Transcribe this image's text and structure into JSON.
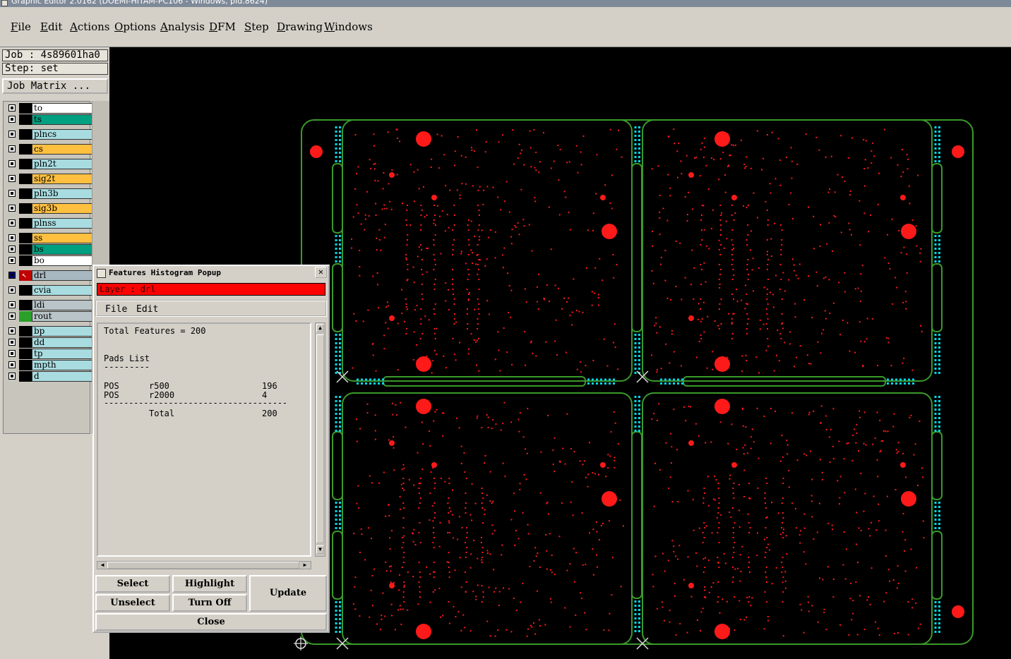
{
  "window": {
    "title": "Graphic Editor 2.0162 (DOEMI-HITAM-PC106 - Windows, pid.8624)"
  },
  "menu": {
    "items": [
      "File",
      "Edit",
      "Actions",
      "Options",
      "Analysis",
      "DFM",
      "Step",
      "Drawing",
      "Windows"
    ]
  },
  "job": {
    "job_label": "Job : 4s89601ha0",
    "step_label": "Step: set",
    "matrix_button": "Job Matrix ..."
  },
  "layers": [
    {
      "name": "to",
      "color": "#ffffff"
    },
    {
      "name": "ts",
      "color": "#00a080"
    },
    {
      "name": "plncs",
      "color": "#a8dce0"
    },
    {
      "name": "cs",
      "color": "#ffc040"
    },
    {
      "name": "pln2t",
      "color": "#a8dce0"
    },
    {
      "name": "sig2t",
      "color": "#ffc040"
    },
    {
      "name": "pln3b",
      "color": "#a8dce0"
    },
    {
      "name": "sig3b",
      "color": "#ffc040"
    },
    {
      "name": "plnss",
      "color": "#a8dce0"
    },
    {
      "name": "ss",
      "color": "#ffc040"
    },
    {
      "name": "bs",
      "color": "#00a080"
    },
    {
      "name": "bo",
      "color": "#ffffff"
    },
    {
      "name": "drl",
      "color": "#a8b8c0"
    },
    {
      "name": "cvia",
      "color": "#a8dce0"
    },
    {
      "name": "ldi",
      "color": "#b8c4c8"
    },
    {
      "name": "rout",
      "color": "#b8c4c8"
    },
    {
      "name": "bp",
      "color": "#a8dce0"
    },
    {
      "name": "dd",
      "color": "#a8dce0"
    },
    {
      "name": "tp",
      "color": "#a8dce0"
    },
    {
      "name": "mpth",
      "color": "#a8dce0"
    },
    {
      "name": "d",
      "color": "#a8dce0"
    }
  ],
  "popup": {
    "title": "Features Histogram Popup",
    "close_glyph": "✕",
    "layer_label": "Layer :  drl",
    "menu": [
      "File",
      "Edit"
    ],
    "total_features": "Total Features = 200",
    "section_title": "Pads List",
    "section_underline": "---------",
    "rows": [
      {
        "type": "POS",
        "symbol": "r500",
        "count": "196"
      },
      {
        "type": "POS",
        "symbol": "r2000",
        "count": "4"
      }
    ],
    "separator": "-------------------------------------",
    "total_label": "Total",
    "total_value": "200",
    "buttons": {
      "select": "Select",
      "highlight": "Highlight",
      "update": "Update",
      "unselect": "Unselect",
      "turn_off": "Turn Off",
      "close": "Close"
    }
  },
  "colors": {
    "canvas_bg": "#000000",
    "outline": "#3a9a2a",
    "drill": "#ff1a1a",
    "tab_dots": "#00d8e8"
  }
}
